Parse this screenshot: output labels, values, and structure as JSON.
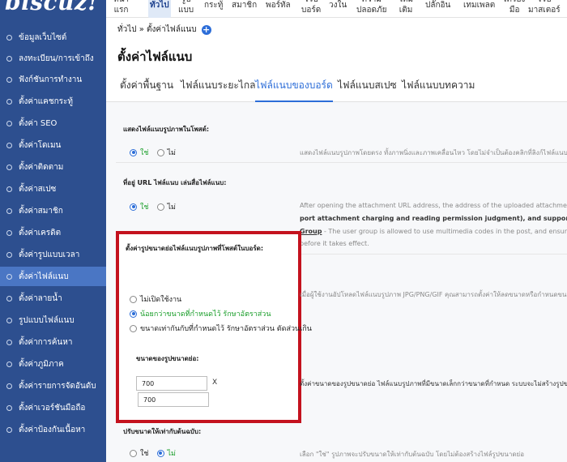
{
  "app": {
    "logo": "biscuz!",
    "topnav": [
      {
        "label": "หน้า\nแรก",
        "active": false
      },
      {
        "label": "ทั่วไป",
        "active": true
      },
      {
        "label": "รูป\nแบบ",
        "active": false
      },
      {
        "label": "กระทู้",
        "active": false
      },
      {
        "label": "สมาชิก",
        "active": false
      },
      {
        "label": "พอร์ทัล",
        "active": false
      },
      {
        "label": "ไวป\nบอร์ด",
        "active": false
      },
      {
        "label": "วงใน",
        "active": false
      },
      {
        "label": "ความ\nปลอดภัย",
        "active": false
      },
      {
        "label": "ใหม่\nเติม",
        "active": false
      },
      {
        "label": "ปลั๊กอิน",
        "active": false
      },
      {
        "label": "เทมเพลต",
        "active": false
      },
      {
        "label": "เครื่อง\nมือ",
        "active": false
      },
      {
        "label": "ไวป\nมาสเตอร์",
        "active": false
      }
    ]
  },
  "sidebar": {
    "items": [
      {
        "label": "ข้อมูลเว็บไซต์",
        "active": false
      },
      {
        "label": "ลงทะเบียน/การเข้าถึง",
        "active": false
      },
      {
        "label": "ฟังก์ชันการทำงาน",
        "active": false
      },
      {
        "label": "ตั้งค่าแคชกระทู้",
        "active": false
      },
      {
        "label": "ตั้งค่า SEO",
        "active": false
      },
      {
        "label": "ตั้งค่าโดเมน",
        "active": false
      },
      {
        "label": "ตั้งค่าติดตาม",
        "active": false
      },
      {
        "label": "ตั้งค่าสเปซ",
        "active": false
      },
      {
        "label": "ตั้งค่าสมาชิก",
        "active": false
      },
      {
        "label": "ตั้งค่าเครดิต",
        "active": false
      },
      {
        "label": "ตั้งค่ารูปแบบเวลา",
        "active": false
      },
      {
        "label": "ตั้งค่าไฟล์แนบ",
        "active": true
      },
      {
        "label": "ตั้งค่าลายน้ำ",
        "active": false
      },
      {
        "label": "รูปแบบไฟล์แนบ",
        "active": false
      },
      {
        "label": "ตั้งค่าการค้นหา",
        "active": false
      },
      {
        "label": "ตั้งค่าภูมิภาค",
        "active": false
      },
      {
        "label": "ตั้งค่ารายการจัดอันดับ",
        "active": false
      },
      {
        "label": "ตั้งค่าเวอร์ชันมือถือ",
        "active": false
      },
      {
        "label": "ตั้งค่าป้องกันเนื้อหา",
        "active": false
      }
    ]
  },
  "main": {
    "breadcrumb": "ทั่วไป » ตั้งค่าไฟล์แนบ",
    "title": "ตั้งค่าไฟล์แนบ",
    "tabs": [
      {
        "label": "ตั้งค่าพื้นฐาน",
        "active": false
      },
      {
        "label": "ไฟล์แนบระยะไกล",
        "active": false
      },
      {
        "label": "ไฟล์แนบของบอร์ด",
        "active": true
      },
      {
        "label": "ไฟล์แนบสเปซ",
        "active": false
      },
      {
        "label": "ไฟล์แนบบทความ",
        "active": false
      }
    ]
  },
  "settings": {
    "show_image": {
      "label": "แสดงไฟล์แนบรูปภาพในโพสต์:",
      "yes": "ใช่",
      "no": "ไม่",
      "desc": "แสดงไฟล์แนบรูปภาพโดยตรง ทั้งภาพนิ่งและภาพเคลื่อนไหว โดยไม่จำเป็นต้องคลิกที่ลิงก์ไฟล์แนบ"
    },
    "url_media": {
      "label": "ที่อยู่ URL ไฟล์แนบ เล่นสื่อไฟล์แนบ:",
      "yes": "ใช่",
      "no": "ไม่",
      "desc1": "After opening the attachment URL address, the address of the uploaded attachment c",
      "desc2": "port attachment charging and reading permission judgment), and supports direct",
      "desc3_link": "Group",
      "desc3_rest": " - The user group is allowed to use multimedia codes in the post, and ensure th",
      "desc4": "before it takes effect."
    },
    "thumb": {
      "label": "ตั้งค่ารูปขนาดย่อไฟล์แนบรูปภาพที่โพสต์ในบอร์ด:",
      "opt1": "ไม่เปิดใช้งาน",
      "opt2": "น้อยกว่าขนาดที่กำหนดไว้ รักษาอัตราส่วน",
      "opt3": "ขนาดเท่ากันกับที่กำหนดไว้ รักษาอัตราส่วน ตัดส่วนเกิน",
      "desc": "เมื่อผู้ใช้งานอัปโหลดไฟล์แนบรูปภาพ JPG/PNG/GIF คุณสามารถตั้งค่าให้ลดขนาดหรือกำหนดขนาด"
    },
    "thumb_size": {
      "label": "ขนาดของรูปขนาดย่อ:",
      "width": "700",
      "times": "X",
      "height": "700",
      "desc": "ตั้งค่าขนาดของรูปขนาดย่อ ไฟล์แนบรูปภาพที่มีขนาดเล็กกว่าขนาดที่กำหนด ระบบจะไม่สร้างรูปขนาด"
    },
    "original_resize": {
      "label": "ปรับขนาดให้เท่ากับต้นฉบับ:",
      "yes": "ใช่",
      "no": "ไม่",
      "desc": "เลือก \"ใช่\" รูปภาพจะปรับขนาดให้เท่ากับต้นฉบับ โดยไม่ต้องสร้างไฟล์รูปขนาดย่อ"
    }
  }
}
